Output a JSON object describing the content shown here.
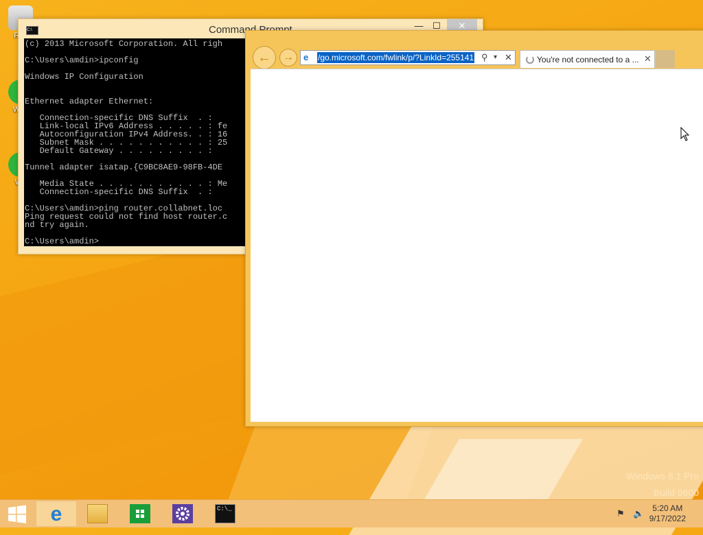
{
  "desktop": {
    "icons": [
      {
        "label": "Rec"
      },
      {
        "label": "Wha"
      },
      {
        "label": "Wh"
      }
    ],
    "watermark": {
      "line1": "Windows 8.1 Pro",
      "line2": "Build 9600"
    }
  },
  "cmd": {
    "title": "Command Prompt",
    "min": "—",
    "max": "☐",
    "close": "✕",
    "lines": [
      "(c) 2013 Microsoft Corporation. All righ",
      "",
      "C:\\Users\\amdin>ipconfig",
      "",
      "Windows IP Configuration",
      "",
      "",
      "Ethernet adapter Ethernet:",
      "",
      "   Connection-specific DNS Suffix  . :",
      "   Link-local IPv6 Address . . . . . : fe",
      "   Autoconfiguration IPv4 Address. . : 16",
      "   Subnet Mask . . . . . . . . . . . : 25",
      "   Default Gateway . . . . . . . . . :",
      "",
      "Tunnel adapter isatap.{C9BC8AE9-98FB-4DE",
      "",
      "   Media State . . . . . . . . . . . : Me",
      "   Connection-specific DNS Suffix  . :",
      "",
      "C:\\Users\\amdin>ping router.collabnet.loc",
      "Ping request could not find host router.c",
      "nd try again.",
      "",
      "C:\\Users\\amdin>"
    ]
  },
  "ie": {
    "address": "/go.microsoft.com/fwlink/p/?LinkId=255141",
    "tab_title": "You're not connected to a ...",
    "back_glyph": "←",
    "fwd_glyph": "→",
    "search_glyph": "⚲",
    "dropdown_glyph": "▾",
    "stop_glyph": "✕",
    "tab_close_glyph": "✕"
  },
  "taskbar": {
    "time": "5:20 AM",
    "date": "9/17/2022",
    "items": [
      {
        "name": "internet-explorer",
        "active": true
      },
      {
        "name": "file-explorer",
        "active": false
      },
      {
        "name": "store",
        "active": false
      },
      {
        "name": "settings",
        "active": false
      },
      {
        "name": "command-prompt",
        "active": false
      }
    ]
  },
  "colors": {
    "accent": "#f5a612",
    "selection": "#0a63c6",
    "taskbar": "#f3c07a"
  }
}
